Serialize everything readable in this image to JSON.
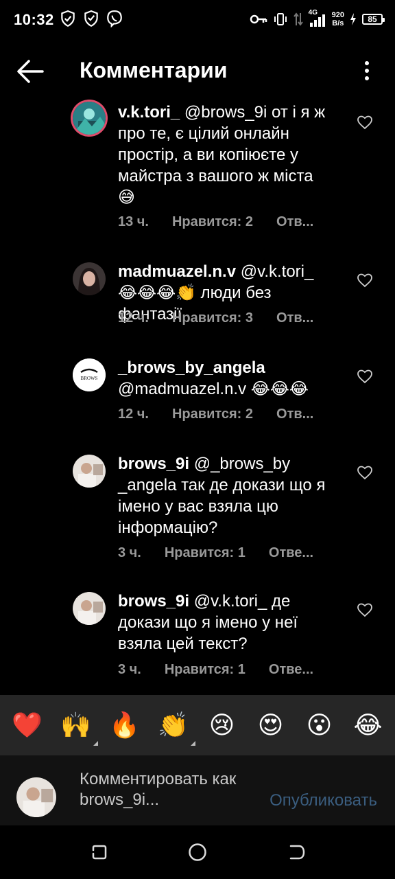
{
  "status_bar": {
    "time": "10:32",
    "net_speed_top": "920",
    "net_speed_bottom": "B/s",
    "signal_label": "4G",
    "battery": "85"
  },
  "header": {
    "title": "Комментарии"
  },
  "comments": [
    {
      "username": "v.k.tori_",
      "text": " @brows_9i от і я ж про те, є цілий онлайн простір, а ви копіюєте у майстра з вашого ж міста 😅",
      "time": "13 ч.",
      "likes": "Нравится: 2",
      "reply": "Отв..."
    },
    {
      "username": "madmuazel.n.v",
      "text": " @v.k.tori_ 😂😂😂👏 люди без фантазії",
      "time": "12 ч.",
      "likes": "Нравится: 3",
      "reply": "Отв..."
    },
    {
      "username": "_brows_by_angela",
      "text": " @madmuazel.n.v 😂😂😂",
      "time": "12 ч.",
      "likes": "Нравится: 2",
      "reply": "Отв..."
    },
    {
      "username": "brows_9i",
      "text": " @_brows_by _angela так де докази що я імено у вас взяла цю інформацію?",
      "time": "3 ч.",
      "likes": "Нравится: 1",
      "reply": "Отве..."
    },
    {
      "username": "brows_9i",
      "text": " @v.k.tori_ де докази що я імено у неї взяла цей текст?",
      "time": "3 ч.",
      "likes": "Нравится: 1",
      "reply": "Отве..."
    }
  ],
  "emoji_bar": [
    "❤️",
    "🙌",
    "🔥",
    "👏",
    "😢",
    "😍",
    "😮",
    "😂"
  ],
  "composer": {
    "placeholder": "Комментировать как brows_9i...",
    "publish_label": "Опубликовать"
  },
  "colors": {
    "background": "#000000",
    "meta_text": "#9a9a9a",
    "publish_disabled": "#3a5d7f",
    "emoji_bar_bg": "#262626"
  }
}
